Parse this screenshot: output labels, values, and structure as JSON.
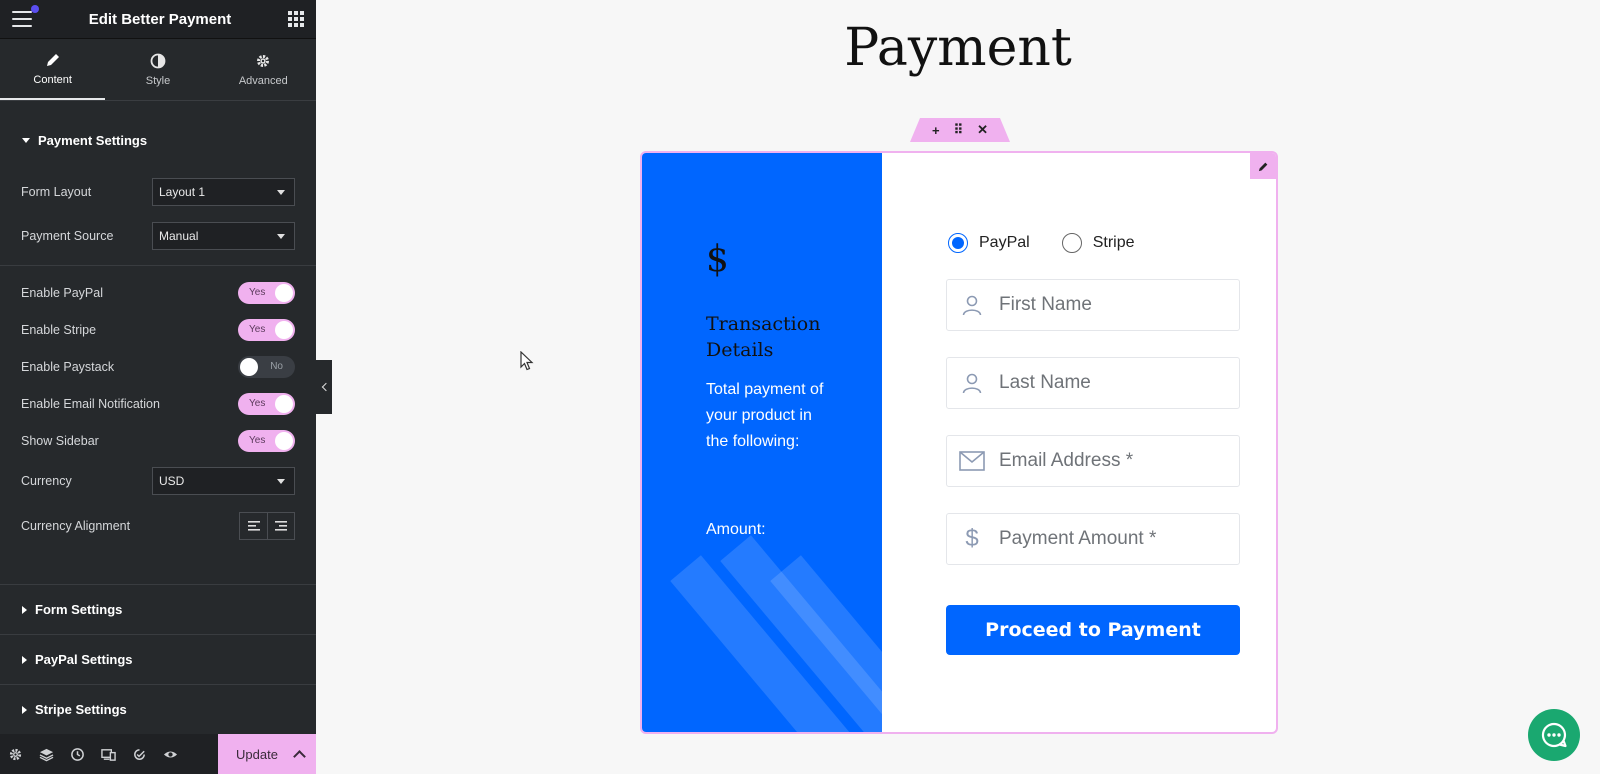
{
  "editor": {
    "title": "Edit Better Payment",
    "tabs": [
      {
        "label": "Content",
        "active": true
      },
      {
        "label": "Style",
        "active": false
      },
      {
        "label": "Advanced",
        "active": false
      }
    ],
    "payment_settings": {
      "title": "Payment Settings",
      "form_layout": {
        "label": "Form Layout",
        "value": "Layout 1"
      },
      "payment_source": {
        "label": "Payment Source",
        "value": "Manual"
      },
      "enable_paypal": {
        "label": "Enable PayPal",
        "state": "Yes"
      },
      "enable_stripe": {
        "label": "Enable Stripe",
        "state": "Yes"
      },
      "enable_paystack": {
        "label": "Enable Paystack",
        "state": "No"
      },
      "enable_email": {
        "label": "Enable Email Notification",
        "state": "Yes"
      },
      "show_sidebar": {
        "label": "Show Sidebar",
        "state": "Yes"
      },
      "currency": {
        "label": "Currency",
        "value": "USD"
      },
      "currency_alignment": {
        "label": "Currency Alignment"
      }
    },
    "sections": [
      "Form Settings",
      "PayPal Settings",
      "Stripe Settings"
    ],
    "update_label": "Update",
    "accent_color": "#f0b1ef"
  },
  "page": {
    "title": "Payment",
    "sidebar": {
      "currency_symbol": "$",
      "title": "Transaction Details",
      "description": "Total payment of your product in the following:",
      "amount_label": "Amount:",
      "background": "#0066ff"
    },
    "form": {
      "methods": [
        {
          "label": "PayPal",
          "checked": true
        },
        {
          "label": "Stripe",
          "checked": false
        }
      ],
      "fields": {
        "first_name": "First Name",
        "last_name": "Last Name",
        "email": "Email Address *",
        "amount": "Payment Amount *"
      },
      "submit_label": "Proceed to Payment"
    }
  }
}
